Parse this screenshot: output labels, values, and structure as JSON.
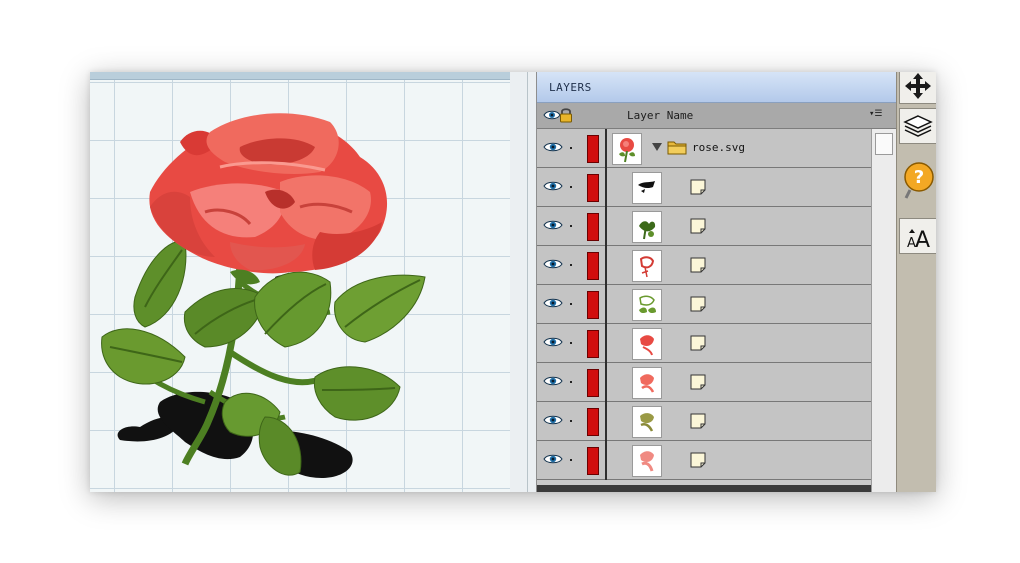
{
  "panel": {
    "title": "LAYERS",
    "header": {
      "column_label": "Layer Name"
    }
  },
  "layers": [
    {
      "name": "rose.svg",
      "type": "group",
      "visible": true,
      "color": "#d10d0d",
      "expanded": true,
      "thumb": "rose"
    },
    {
      "name": "",
      "type": "child",
      "visible": true,
      "color": "#d10d0d",
      "thumb": "shadow"
    },
    {
      "name": "",
      "type": "child",
      "visible": true,
      "color": "#d10d0d",
      "thumb": "dark-green"
    },
    {
      "name": "",
      "type": "child",
      "visible": true,
      "color": "#d10d0d",
      "thumb": "red-outline"
    },
    {
      "name": "",
      "type": "child",
      "visible": true,
      "color": "#d10d0d",
      "thumb": "green"
    },
    {
      "name": "",
      "type": "child",
      "visible": true,
      "color": "#d10d0d",
      "thumb": "red"
    },
    {
      "name": "",
      "type": "child",
      "visible": true,
      "color": "#d10d0d",
      "thumb": "red-light"
    },
    {
      "name": "",
      "type": "child",
      "visible": true,
      "color": "#d10d0d",
      "thumb": "olive"
    },
    {
      "name": "",
      "type": "child",
      "visible": true,
      "color": "#d10d0d",
      "thumb": "pink"
    }
  ],
  "toolbar": {
    "tools": [
      "move-icon",
      "layers-icon",
      "help-icon",
      "text-size-icon"
    ],
    "text_tool_label": "AA"
  },
  "colors": {
    "layer_color": "#d10d0d",
    "panel_bg": "#c4c4c4",
    "title_bar": "#c4d6f0",
    "rose_red": "#e84a43",
    "leaf_green": "#5e8f2a"
  }
}
